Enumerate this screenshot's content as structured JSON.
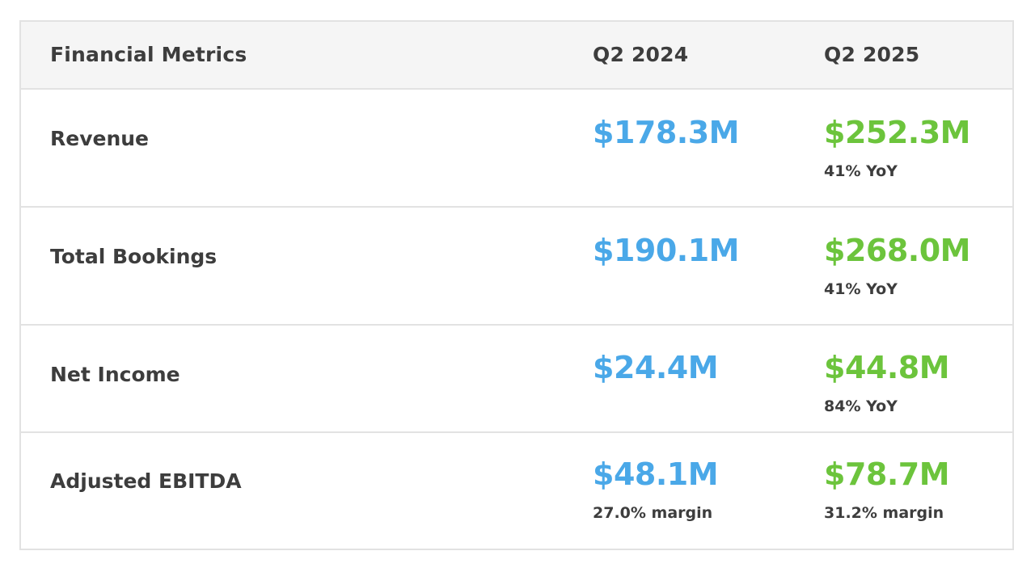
{
  "header": {
    "label": "Financial Metrics",
    "col1": "Q2 2024",
    "col2": "Q2 2025"
  },
  "rows": [
    {
      "label": "Revenue",
      "q2_2024": {
        "value": "$178.3M",
        "note": ""
      },
      "q2_2025": {
        "value": "$252.3M",
        "note": "41% YoY"
      }
    },
    {
      "label": "Total Bookings",
      "q2_2024": {
        "value": "$190.1M",
        "note": ""
      },
      "q2_2025": {
        "value": "$268.0M",
        "note": "41% YoY"
      }
    },
    {
      "label": "Net Income",
      "q2_2024": {
        "value": "$24.4M",
        "note": ""
      },
      "q2_2025": {
        "value": "$44.8M",
        "note": "84% YoY"
      }
    },
    {
      "label": "Adjusted EBITDA",
      "q2_2024": {
        "value": "$48.1M",
        "note": "27.0% margin"
      },
      "q2_2025": {
        "value": "$78.7M",
        "note": "31.2% margin"
      }
    }
  ],
  "colors": {
    "q2_2024_value": "#4aa8e8",
    "q2_2025_value": "#6cc43c",
    "text": "#3d3d3d",
    "header_bg": "#f5f5f5",
    "border": "#e2e2e2"
  }
}
